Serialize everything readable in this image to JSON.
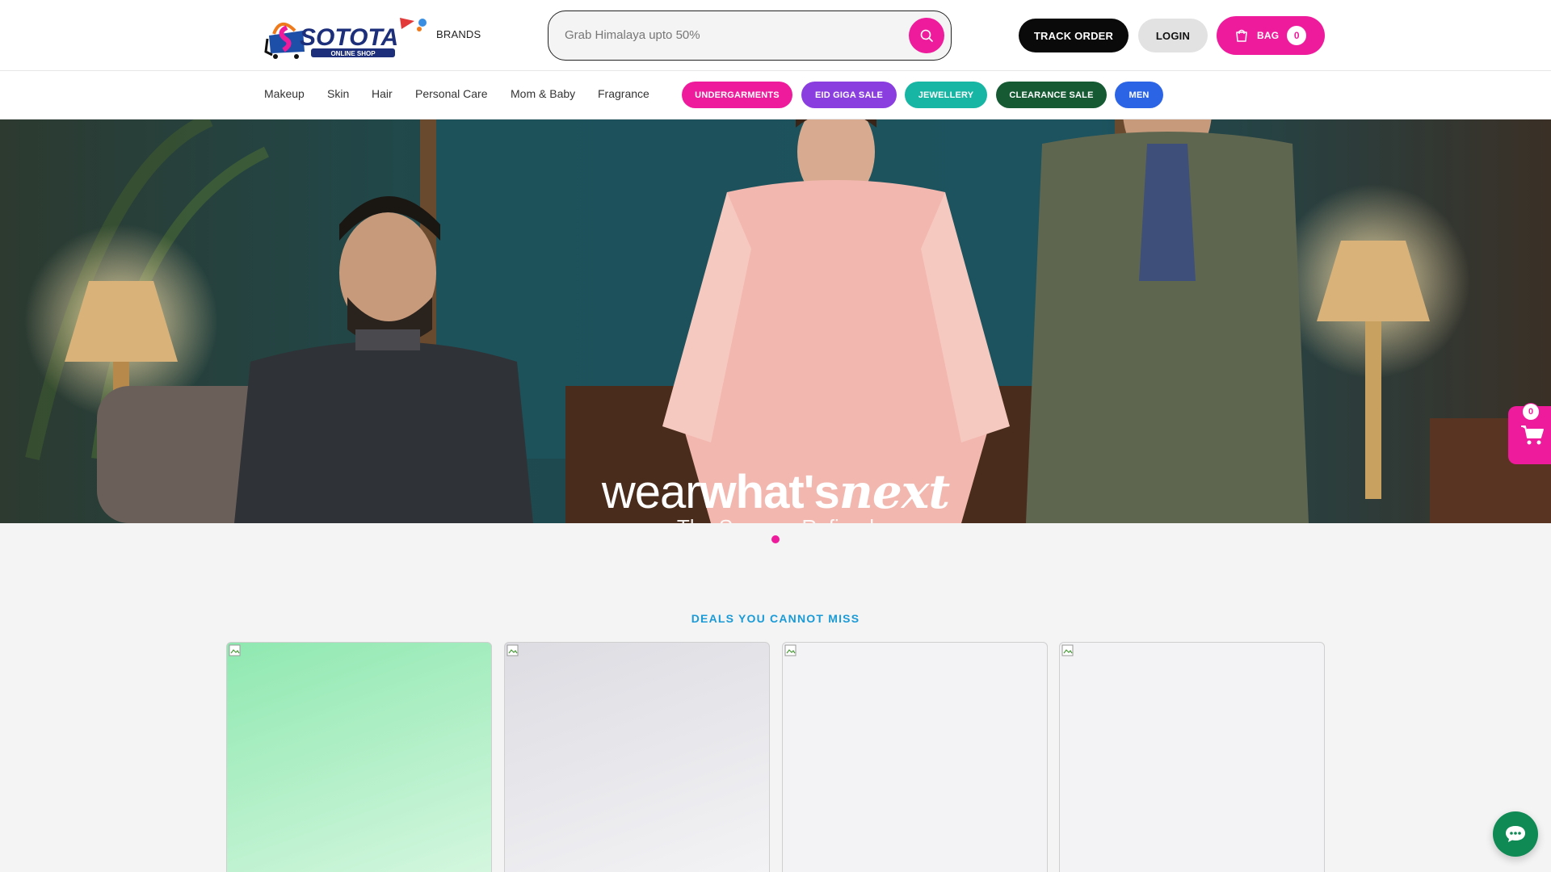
{
  "header": {
    "logo_text": "SOTOTA",
    "logo_subtext": "ONLINE SHOP",
    "brands_label": "BRANDS",
    "search_placeholder": "Grab Himalaya upto 50%",
    "track_order_label": "TRACK ORDER",
    "login_label": "LOGIN",
    "bag_label": "BAG",
    "bag_count": "0"
  },
  "nav": {
    "categories": [
      "Makeup",
      "Skin",
      "Hair",
      "Personal Care",
      "Mom & Baby",
      "Fragrance"
    ],
    "pills": [
      {
        "label": "UNDERGARMENTS",
        "color": "#ee1c9c"
      },
      {
        "label": "EID GIGA SALE",
        "color": "#8a3ee0"
      },
      {
        "label": "JEWELLERY",
        "color": "#17b5a3"
      },
      {
        "label": "CLEARANCE SALE",
        "color": "#155a33"
      },
      {
        "label": "MEN",
        "color": "#2c64e6"
      }
    ]
  },
  "hero": {
    "tagline_part1": "wear",
    "tagline_part2": "what's",
    "tagline_part3": "next",
    "subtitle": "The Season, Refined"
  },
  "deals": {
    "title": "DEALS YOU CANNOT MISS",
    "cards": [
      {
        "background": "#8fe8b0"
      },
      {
        "background": "#e4e4e8"
      },
      {
        "background": "#f3f3f5"
      },
      {
        "background": "#f3f3f5"
      }
    ]
  },
  "floating_cart": {
    "count": "0"
  },
  "colors": {
    "accent": "#ee1c9c",
    "deals_title": "#1a9ad6",
    "chat": "#0f8a55"
  }
}
